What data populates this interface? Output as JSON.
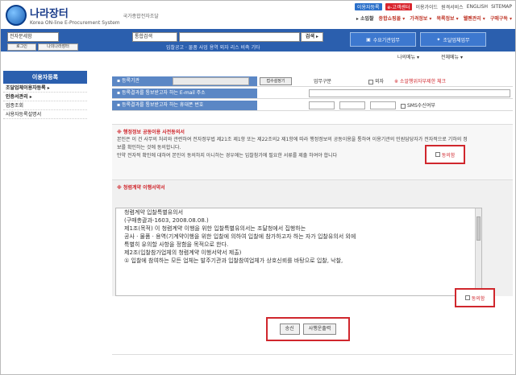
{
  "header": {
    "logo_title": "나라장터",
    "logo_subtitle": "Korea ON-line E-Procurement System",
    "logo_tag": "국가종합전자조달",
    "top_links": [
      {
        "label": "이용자등록",
        "style": "badge2"
      },
      {
        "label": "e-고객센터",
        "style": "badge"
      },
      {
        "label": "이용가이드",
        "style": "plain"
      },
      {
        "label": "원격서비스",
        "style": "plain"
      },
      {
        "label": "ENGLISH",
        "style": "plain"
      },
      {
        "label": "SITEMAP",
        "style": "plain"
      }
    ],
    "sub_nav": [
      {
        "label": "▸ 소입찰",
        "style": "alt"
      },
      {
        "label": "종합쇼핑몰 ▾",
        "style": "red"
      },
      {
        "label": "가격정보 ▾",
        "style": "red"
      },
      {
        "label": "목록정보 ▾",
        "style": "red"
      },
      {
        "label": "웰펜관리 ▾",
        "style": "red"
      },
      {
        "label": "구매구독 ▾",
        "style": "red"
      }
    ]
  },
  "bluebar": {
    "left_select": "전자문세함",
    "category_select": "통합검색",
    "search_button": "검색 ▸",
    "login_button": "로그인",
    "join_button": "나의나라장터",
    "quick_links": "입찰공고  ·  물품 사업 용역 외자 리스 비축 기타",
    "demand_button": "수요기관업무",
    "supply_button": "조달업체업무"
  },
  "menus": {
    "my_menu": "나의메뉴 ▾",
    "all_menu": "전체메뉴 ▾"
  },
  "sidebar": {
    "header": "이용자등록",
    "items": [
      {
        "label": "조달업체이용자등록 ▸",
        "selected": true
      },
      {
        "label": "인증서관리 ▸",
        "selected": true
      },
      {
        "label": "업종조회",
        "selected": false
      },
      {
        "label": "사용자등록설명서",
        "selected": false
      }
    ]
  },
  "form": {
    "row1_label": "▪ 등록기관",
    "row1_pin_button": "접수설정기",
    "row1_biz_label": "업무구분",
    "row1_foreign": "외자",
    "row1_note": "※ 소알행위자부제한 체크",
    "row2_label": "▪ 등록결과를 통보받고자 하는 E-mail 주소",
    "row3_label": "▪ 등록결과를 통보받고자 하는 휴대폰 번호",
    "row3_sms": "SMS수신여부"
  },
  "notice": {
    "title": "※ 행정정보 공동이용 사전동의서",
    "text": "본인은 이 건 사무의 처리와 관련하여 전자정부법 제21조 제1항 또는 제22조의2 제1항에 따라 행정정보의 공동이용을 통하여 이용기관의 민원담당자가 전자적으로 기하의 정보를 확인하는 것에 동의합니다.",
    "text2": "만약 전자적 확인에 대하여 본인이 동의하지 아니하는 경우에는 입찰참가에 필요한 서류를 제출 하여야 합니다",
    "agree": "동의함"
  },
  "contract": {
    "title": "※ 청렴계약 이행서약서",
    "lines": [
      "",
      "청렴계약 입찰특별유의서",
      "",
      "(구매총괄과-1603, 2008.08.08.)",
      "제1조(목적) 이 청렴계약 이행을 위한 입찰특별유의서는 조달청에서 집행하는",
      "공사 · 물품 · 용역(기계약이행을 위한 입찰에 의하여 입찰에 참가하고자 하는 자가 입찰유의서 외에",
      "특별히 유의할 사항을 정함을 목적으로 한다.",
      "",
      "제2조(입찰참가업체의 청렴계약 이행서약서 제출)",
      "① 입찰에 참여하는 모든 업체는 발주기관과 입찰참여업체가 상호신뢰를 바탕으로 입찰, 낙찰,"
    ],
    "agree": "동의함"
  },
  "actions": {
    "send": "송신",
    "bidder_login": "사행운출력"
  }
}
